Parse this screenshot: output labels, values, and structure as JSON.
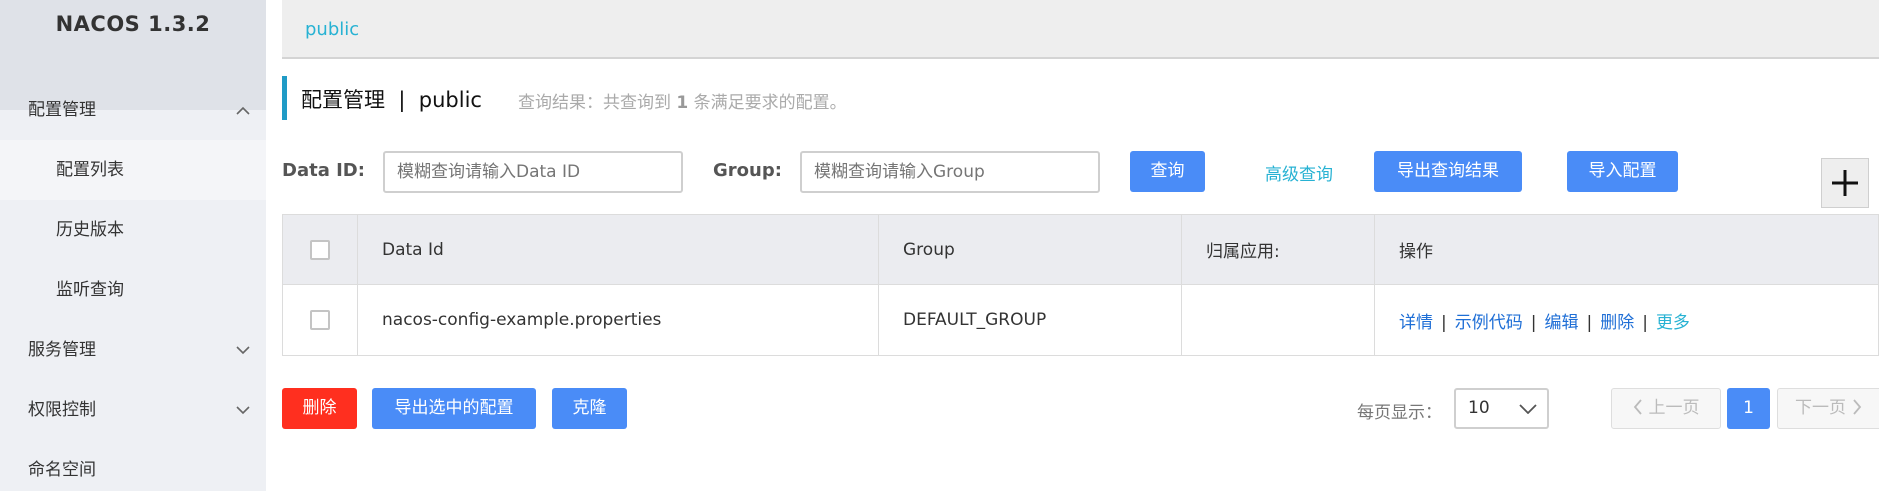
{
  "app": {
    "title": "NACOS 1.3.2"
  },
  "sidebar": {
    "items": [
      {
        "label": "配置管理"
      },
      {
        "label": "配置列表"
      },
      {
        "label": "历史版本"
      },
      {
        "label": "监听查询"
      },
      {
        "label": "服务管理"
      },
      {
        "label": "权限控制"
      },
      {
        "label": "命名空间"
      }
    ]
  },
  "namespace_bar": {
    "current": "public"
  },
  "header": {
    "title": "配置管理  |  public",
    "result_prefix": "查询结果：共查询到 ",
    "result_count": "1",
    "result_suffix": " 条满足要求的配置。"
  },
  "search": {
    "data_id_label": "Data ID:",
    "data_id_placeholder": "模糊查询请输入Data ID",
    "group_label": "Group:",
    "group_placeholder": "模糊查询请输入Group",
    "query_button": "查询",
    "advanced_link": "高级查询",
    "export_results_button": "导出查询结果",
    "import_button": "导入配置"
  },
  "table": {
    "columns": [
      "Data Id",
      "Group",
      "归属应用:",
      "操作"
    ],
    "rows": [
      {
        "data_id": "nacos-config-example.properties",
        "group": "DEFAULT_GROUP",
        "app": ""
      }
    ],
    "actions": [
      "详情",
      "示例代码",
      "编辑",
      "删除",
      "更多"
    ]
  },
  "footer": {
    "delete_button": "删除",
    "export_selected_button": "导出选中的配置",
    "clone_button": "克隆",
    "per_page_label": "每页显示：",
    "per_page_value": "10",
    "prev_page": "上一页",
    "current_page": "1",
    "next_page": "下一页"
  },
  "colors": {
    "primary": "#4a8cf7",
    "danger": "#ff2f1f",
    "accent": "#27b2d3"
  }
}
